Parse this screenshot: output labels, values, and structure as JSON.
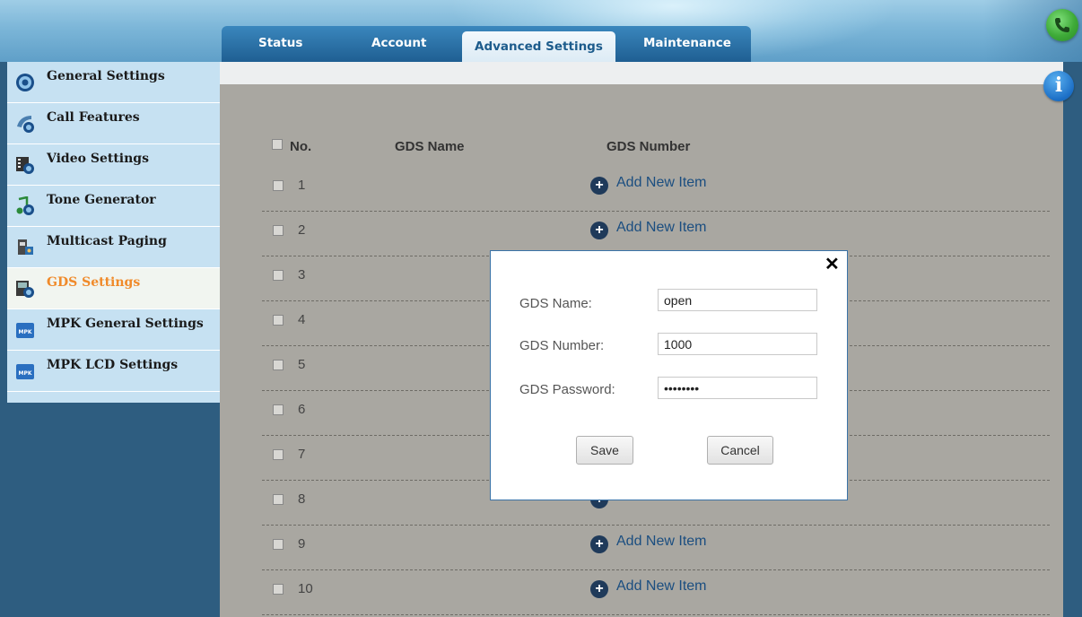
{
  "header": {
    "tabs": [
      {
        "label": "Status"
      },
      {
        "label": "Account"
      },
      {
        "label": "Advanced Settings",
        "active": true
      },
      {
        "label": "Maintenance"
      }
    ],
    "call_icon": "phone-icon",
    "info_icon": "info-icon"
  },
  "sidebar": {
    "items": [
      {
        "label": "General Settings",
        "icon": "gear-icon"
      },
      {
        "label": "Call Features",
        "icon": "call-features-icon"
      },
      {
        "label": "Video Settings",
        "icon": "video-icon"
      },
      {
        "label": "Tone Generator",
        "icon": "music-note-icon"
      },
      {
        "label": "Multicast Paging",
        "icon": "paging-icon"
      },
      {
        "label": "GDS Settings",
        "icon": "gds-icon",
        "active": true
      },
      {
        "label": "MPK General Settings",
        "icon": "mpk-icon"
      },
      {
        "label": "MPK LCD Settings",
        "icon": "mpk-icon"
      }
    ]
  },
  "table": {
    "headers": {
      "no": "No.",
      "name": "GDS Name",
      "number": "GDS Number"
    },
    "add_label": "Add New Item",
    "rows": [
      "1",
      "2",
      "3",
      "4",
      "5",
      "6",
      "7",
      "8",
      "9",
      "10"
    ]
  },
  "modal": {
    "close_glyph": "✕",
    "fields": [
      {
        "label": "GDS Name:",
        "value": "open"
      },
      {
        "label": "GDS Number:",
        "value": "1000"
      },
      {
        "label": "GDS Password:",
        "value": "password"
      }
    ],
    "save_label": "Save",
    "cancel_label": "Cancel"
  },
  "colors": {
    "accent_active": "#f08a2a",
    "tab_bar": "#1f5f92",
    "link": "#1b4e80"
  }
}
